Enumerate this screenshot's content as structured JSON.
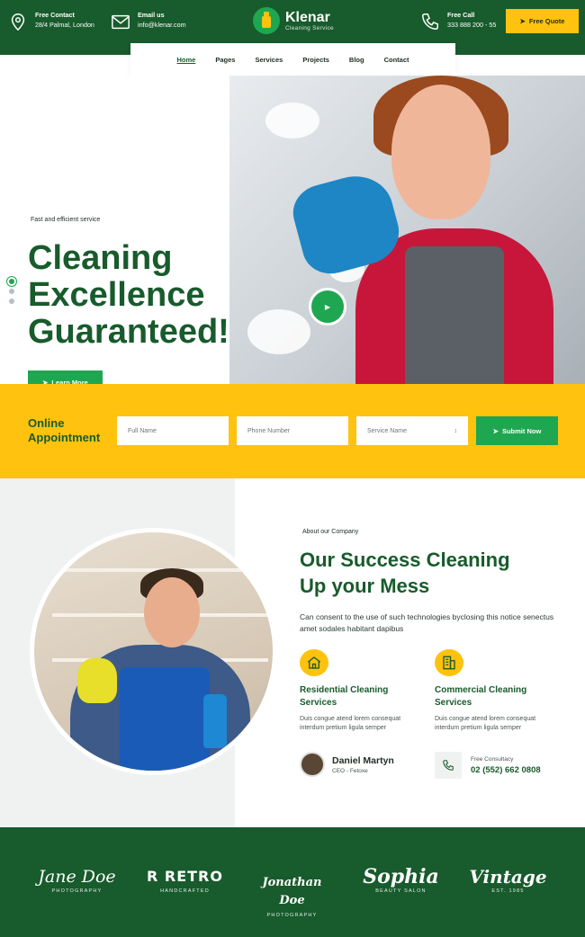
{
  "topbar": {
    "contact": {
      "label": "Free Contact",
      "value": "28/4 Palmal, London"
    },
    "email": {
      "label": "Email us",
      "value": "info@klenar.com"
    },
    "brand": {
      "name": "Klenar",
      "tagline": "Cleaning Service"
    },
    "call": {
      "label": "Free Call",
      "value": "333 888 200 - 55"
    },
    "quote_label": "Free Quote"
  },
  "nav": {
    "items": [
      "Home",
      "Pages",
      "Services",
      "Projects",
      "Blog",
      "Contact"
    ],
    "active": "Home"
  },
  "hero": {
    "tag": "Fast and efficient service",
    "title_lines": [
      "Cleaning",
      "Excellence",
      "Guaranteed!"
    ],
    "button_label": "Learn More",
    "slides": 3,
    "active_slide": 1
  },
  "appointment": {
    "title_lines": [
      "Online",
      "Appointment"
    ],
    "fields": {
      "full_name": "Full Name",
      "phone": "Phone Number",
      "service": "Service Name"
    },
    "submit_label": "Submit Now"
  },
  "about": {
    "tag": "About our Company",
    "title_lines": [
      "Our Success Cleaning",
      "Up your Mess"
    ],
    "description": "Can consent to the use of such technologies byclosing this notice senectus amet sodales habitant dapibus",
    "services": [
      {
        "title": "Residential Cleaning Services",
        "desc": "Duis congue atend lorem consequat interdum pretium ligula semper",
        "icon": "house-icon"
      },
      {
        "title": "Commercial Cleaning Services",
        "desc": "Duis congue atend lorem consequat interdum pretium ligula semper",
        "icon": "building-icon"
      }
    ],
    "person": {
      "name": "Daniel Martyn",
      "role": "CEO - Fetoxe"
    },
    "consult": {
      "label": "Free Consultacy",
      "number": "02 (552) 662 0808"
    }
  },
  "brands": [
    {
      "main": "Jane Doe",
      "sub": "PHOTOGRAPHY"
    },
    {
      "main": "R RETRO",
      "sub": "HANDCRAFTED"
    },
    {
      "main": "Jonathan Doe",
      "sub": "PHOTOGRAPHY"
    },
    {
      "main": "Sophia",
      "sub": "BEAUTY SALON"
    },
    {
      "main": "Vintage",
      "sub": "EST. 1985"
    }
  ],
  "colors": {
    "primary_green": "#185b2c",
    "accent_green": "#1fa651",
    "accent_yellow": "#ffc20e"
  }
}
